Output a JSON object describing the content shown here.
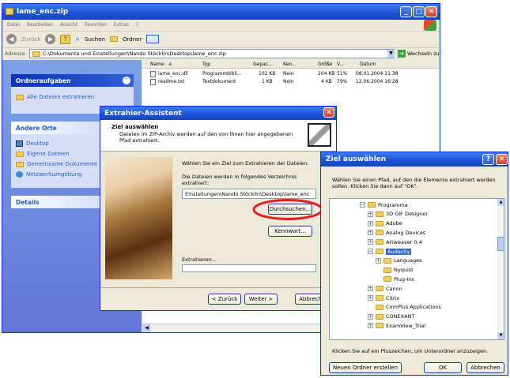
{
  "explorer": {
    "title": "lame_enc.zip",
    "menu": [
      "Datei",
      "Bearbeiten",
      "Ansicht",
      "Favoriten",
      "Extras",
      "?"
    ],
    "toolbar": {
      "back": "Zurück",
      "search": "Suchen",
      "folders": "Ordner"
    },
    "address_label": "Adresse",
    "address_value": "C:\\Dokumente und Einstellungen\\Nando Stöcklin\\Desktop\\lame_enc.zip",
    "go_label": "Wechseln zu",
    "sidebar": {
      "tasks_title": "Ordneraufgaben",
      "tasks": [
        "Alle Dateien extrahieren"
      ],
      "places_title": "Andere Orte",
      "places": [
        "Desktop",
        "Eigene Dateien",
        "Gemeinsame Dokumente",
        "Netzwerkumgebung"
      ],
      "details_title": "Details"
    },
    "columns": [
      "Name",
      "Typ",
      "Gepac...",
      "Ken...",
      "Größe",
      "V...",
      "Datum"
    ],
    "files": [
      [
        "lame_enc.dll",
        "Programmbibli...",
        "102 KB",
        "Nein",
        "204 KB",
        "51%",
        "08.01.2004 11:38"
      ],
      [
        "readme.txt",
        "Textdokument",
        "1 KB",
        "Nein",
        "4 KB",
        "79%",
        "12.06.2004 16:28"
      ]
    ]
  },
  "wizard": {
    "title": "Extrahier-Assistent",
    "heading": "Ziel auswählen",
    "subheading": "Dateien im ZIP-Archiv werden auf den von Ihnen hier angegebenen Pfad extrahiert.",
    "instruction": "Wählen Sie ein Ziel zum Extrahieren der Dateien.",
    "dir_label": "Die Dateien werden in folgendes Verzeichnis extrahiert:",
    "dir_value": "Einstellungen\\Nando Stöcklin\\Desktop\\lame_enc",
    "browse": "Durchsuchen...",
    "password": "Kennwort...",
    "extracting": "Extrahieren...",
    "back": "< Zurück",
    "next": "Weiter >",
    "cancel": "Abbrechen"
  },
  "browse": {
    "title": "Ziel auswählen",
    "description": "Wählen Sie einen Pfad, auf den die Elemente extrahiert werden sollen. Klicken Sie dann auf \"OK\".",
    "tree": [
      {
        "label": "Programme",
        "level": 0,
        "expander": "minus",
        "selected": false
      },
      {
        "label": "3D GIF Designer",
        "level": 1,
        "expander": "plus",
        "selected": false
      },
      {
        "label": "Adobe",
        "level": 1,
        "expander": "plus",
        "selected": false
      },
      {
        "label": "Analog Devices",
        "level": 1,
        "expander": "plus",
        "selected": false
      },
      {
        "label": "Artweaver 0.4",
        "level": 1,
        "expander": "plus",
        "selected": false
      },
      {
        "label": "Audacity",
        "level": 1,
        "expander": "minus",
        "selected": true
      },
      {
        "label": "Languages",
        "level": 2,
        "expander": "plus",
        "selected": false
      },
      {
        "label": "Nyquist",
        "level": 2,
        "expander": "",
        "selected": false
      },
      {
        "label": "Plug-Ins",
        "level": 2,
        "expander": "",
        "selected": false
      },
      {
        "label": "Canon",
        "level": 1,
        "expander": "plus",
        "selected": false
      },
      {
        "label": "Citrix",
        "level": 1,
        "expander": "plus",
        "selected": false
      },
      {
        "label": "ComPlus Applications",
        "level": 1,
        "expander": "",
        "selected": false
      },
      {
        "label": "CONEXANT",
        "level": 1,
        "expander": "plus",
        "selected": false
      },
      {
        "label": "ExamView_Trial",
        "level": 1,
        "expander": "plus",
        "selected": false
      }
    ],
    "hint": "Klicken Sie auf ein Pluszeichen, um Unterordner anzuzeigen.",
    "new_folder": "Neuen Ordner erstellen",
    "ok": "OK",
    "cancel": "Abbrechen"
  },
  "colors": {
    "xp_blue": "#1a52d6",
    "highlight": "#316ac5",
    "callout": "#e02020"
  }
}
